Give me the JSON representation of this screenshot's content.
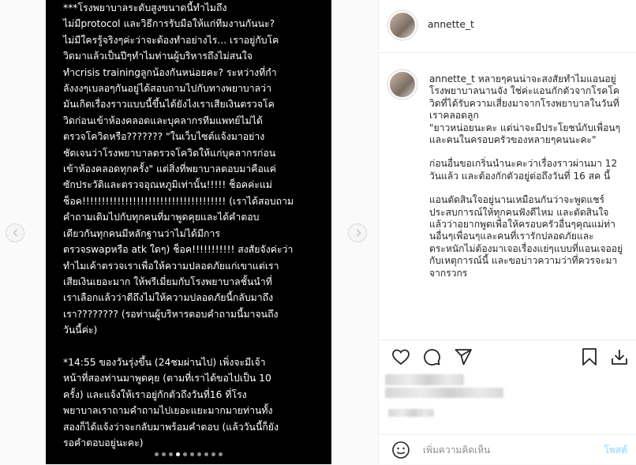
{
  "post": {
    "text": "***โรงพยาบาลระดับสูงขนาดนี้ทำไมถึง\nไม่มีprotocol และวิธีการรับมือให้แก่ทีมงานกันนะ?\nไม่มีใครรู้จริงๆค่ะว่าจะต้องทำอย่างไร... เราอยู่กับโค\nวิดมาแล้วเป็นปีๆทำไมท่านผู้บริหารถึงไม่สนใจ\nทำcrisis trainingลูกน้องกันหน่อยคะ? ระหว่างที่กำ\nลังงงๆเบลอๆกันอยู่ได้สอบถามไปกับทางพยาบาลว่า\nมันเกิดเรื่องราวแบบนี้ขึ้นได้ยังไงเราเสียเงินตรวจโค\nวิดก่อนเข้าห้องคลอดและบุคลากรทีมแพทย์ไม่ได้\nตรวจโควิดหรือ??????? \"ในเว็บไซต์แจ้งมาอย่าง\nชัดเจนว่าโรงพยาบาลตรวจโควิดให้แก่บุคลากรก่อน\nเข้าห้องคลอดทุกครั้ง\" แต่สิ่งที่พยาบาลตอบมาคือแค่\nซักประวัติและตรวจอุณหภูมิเท่านั้น!!!!! ช็อคค่ะแม่\nช็อค!!!!!!!!!!!!!!!!!!!!!!!!!!!!!!!!!!!!! (เราได้สอบถาม\nคำถามเดิมไปกับทุกคนที่มาพูดคุยและได้คำตอบ\nเดียวกันทุกคนมีหลักฐานว่าไม่ได้มีการ\nตรวจswapหรือ atk ใดๆ) ช็อค!!!!!!!!!!! สงสัยจังค่ะว่า\nทำไมเค้าตรวจเราเพื่อให้ความปลอดภัยแก่เขาแต่เรา\nเสียเงินเยอะมาก ให้พรีเมี่ยมกับโรงพยาบาลชั้นนำที่\nเราเลือกแล้วว่าดีถึงไม่ให้ความปลอดภัยนี้กลับมาถึง\nเรา???????? (รอท่านผู้บริหารตอบคำถามนี้มาจนถึง\nวันนี้ค่ะ)\n\n*14:55 ของวันรุ่งขึ้น (24ชมผ่านไป) เพิ่งจะมีเจ้า\nหน้าที่สองท่านมาพูดคุย (ตามที่เราได้ขอไปเป็น 10\nครั้ง) และแจ้งให้เราอยู่กักตัวถึงวันที่16 ที่โรง\nพยาบาลเราถามคำถามไปเยอะแยะมากมายท่านทั้ง\nสองก็ได้แจ้งว่าจะกลับมาพร้อมคำตอบ (แล้ววันนี้ก็ยัง\nรอคำตอบอยู่นะคะ)",
    "carousel": {
      "total": 10,
      "active_index": 3
    }
  },
  "header": {
    "username": "annette_t"
  },
  "caption": {
    "username": "annette_t",
    "paragraphs": [
      "หลายๆคนน่าจะสงสัยทำไมแอนอยู่โรงพยาบาลนานจัง ใช่ค่ะแอนกักตัวจากโรคโควิดที่ได้รับความเสี่ยงมาจากโรงพยาบาลในวันที่เราคลอดลูก\n\"ยาวหน่อยนะคะ แต่น่าจะมีประโยชน์กับเพื่อนๆและคนในครอบครัวของหลายๆคนนะคะ\"",
      "ก่อนอื่นขอเกริ่นนำนะคะว่าเรื่องราวผ่านมา 12 วันแล้ว และต้องกักตัวอยู่ต่อถึงวันที่ 16 สค นี้",
      "แอนตัดสินใจอยู่นานเหมือนกันว่าจะพูดแชร์ประสบการณ์ให้ทุกคนฟังดีไหม และตัดสินใจแล้วว่าอยากพูดเพื่อให้ครอบครัวอื่นๆคุณแม่ท่านอื่นๆเพื่อนๆและคนที่เรารักปลอดภัยและตระหนักไม่ต้องมาเจอเรื่องแย่ๆแบบที่แอนเจออยู่กับเหตุการณ์นี้ และขอบ่าวความว่าที่ควรจะมาจากรวกร"
    ]
  },
  "comment": {
    "placeholder": "เพิ่มความคิดเห็น",
    "post_label": "โพสต์"
  },
  "icons": {
    "like": "heart-icon",
    "comment": "comment-icon",
    "share": "share-icon",
    "save": "bookmark-icon",
    "download": "download-icon",
    "emoji": "emoji-icon",
    "prev": "chevron-left-icon",
    "next": "chevron-right-icon"
  }
}
